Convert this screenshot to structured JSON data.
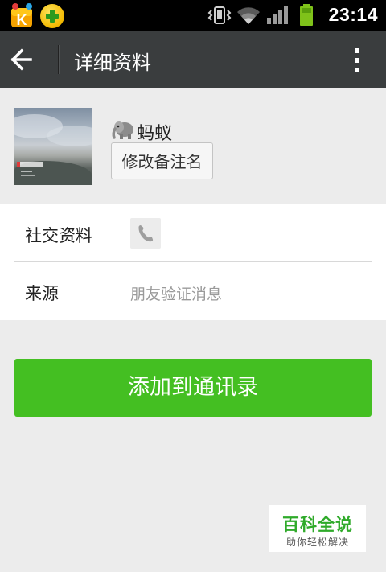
{
  "status_bar": {
    "time": "23:14",
    "left_icons": [
      "kugou-music-icon",
      "360-security-icon"
    ],
    "right_icons": [
      "vibrate-icon",
      "wifi-icon",
      "signal-icon",
      "battery-icon"
    ]
  },
  "action_bar": {
    "title": "详细资料",
    "back_icon": "arrow-left-icon",
    "more_icon": "more-vertical-icon"
  },
  "profile": {
    "nickname": "蚂蚁",
    "nickname_emoji": "elephant-icon",
    "remark_button_label": "修改备注名"
  },
  "info_rows": [
    {
      "label": "社交资料",
      "icon": "phone-icon"
    },
    {
      "label": "来源",
      "value": "朋友验证消息"
    }
  ],
  "add_button_label": "添加到通讯录",
  "watermark": {
    "title": "百科全说",
    "subtitle": "助你轻松解决"
  },
  "colors": {
    "status_bar": "#000000",
    "action_bar": "#3a3d3e",
    "background": "#ececec",
    "primary_button": "#44bf22",
    "watermark_green": "#2faa2a"
  }
}
